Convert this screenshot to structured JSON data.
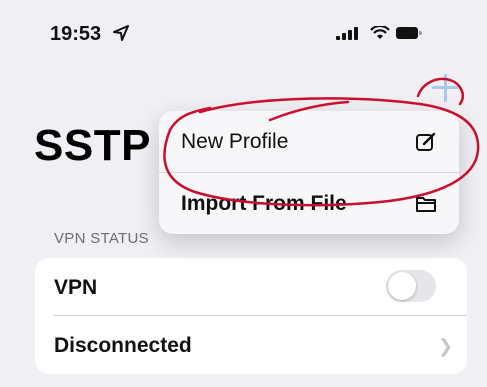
{
  "status_bar": {
    "time": "19:53",
    "icons": [
      "location-arrow-icon",
      "signal-icon",
      "wifi-icon",
      "battery-icon"
    ]
  },
  "nav": {
    "title": "SSTP",
    "add_icon": "plus-icon"
  },
  "menu": {
    "items": [
      {
        "label": "New Profile",
        "icon": "compose-icon"
      },
      {
        "label": "Import From File",
        "icon": "folder-icon"
      }
    ]
  },
  "vpn_status": {
    "section_header": "VPN STATUS",
    "rows": [
      {
        "label": "VPN",
        "toggle_on": false
      },
      {
        "label": "Disconnected",
        "accessory": "chevron-right-icon"
      }
    ]
  },
  "colors": {
    "background": "#f0eff4",
    "card": "#ffffff",
    "accent": "#a9c8ee",
    "annotation": "#c8102e"
  }
}
